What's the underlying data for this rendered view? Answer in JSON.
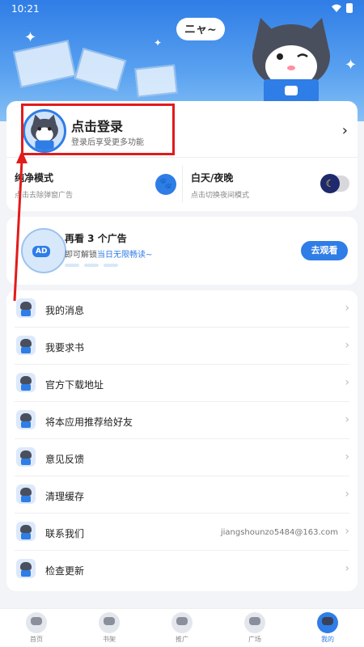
{
  "status_bar": {
    "time": "10:21"
  },
  "header": {
    "bubble_text": "ニャ~"
  },
  "profile": {
    "login_title": "点击登录",
    "login_subtitle": "登录后享受更多功能"
  },
  "modes": {
    "pure": {
      "title": "纯净模式",
      "subtitle": "点击去除弹窗广告"
    },
    "daynight": {
      "title": "白天/夜晚",
      "subtitle": "点击切换夜间模式"
    }
  },
  "ad": {
    "title": "再看 3 个广告",
    "subtitle_prefix": "即可解锁",
    "subtitle_highlight": "当日无限畅读~",
    "badge": "AD",
    "button": "去观看"
  },
  "menu": {
    "items": [
      {
        "label": "我的消息",
        "value": ""
      },
      {
        "label": "我要求书",
        "value": ""
      },
      {
        "label": "官方下载地址",
        "value": ""
      },
      {
        "label": "将本应用推荐给好友",
        "value": ""
      },
      {
        "label": "意见反馈",
        "value": ""
      },
      {
        "label": "清理缓存",
        "value": ""
      },
      {
        "label": "联系我们",
        "value": "jiangshounzo5484@163.com"
      },
      {
        "label": "检查更新",
        "value": ""
      }
    ]
  },
  "tabs": [
    {
      "label": "首页",
      "icon": "home-icon",
      "active": false
    },
    {
      "label": "书架",
      "icon": "bookshelf-icon",
      "active": false
    },
    {
      "label": "推广",
      "icon": "promote-icon",
      "active": false
    },
    {
      "label": "广场",
      "icon": "plaza-icon",
      "active": false
    },
    {
      "label": "我的",
      "icon": "profile-icon",
      "active": true
    }
  ],
  "colors": {
    "accent": "#2f7de6",
    "annotation": "#e21b1b"
  }
}
